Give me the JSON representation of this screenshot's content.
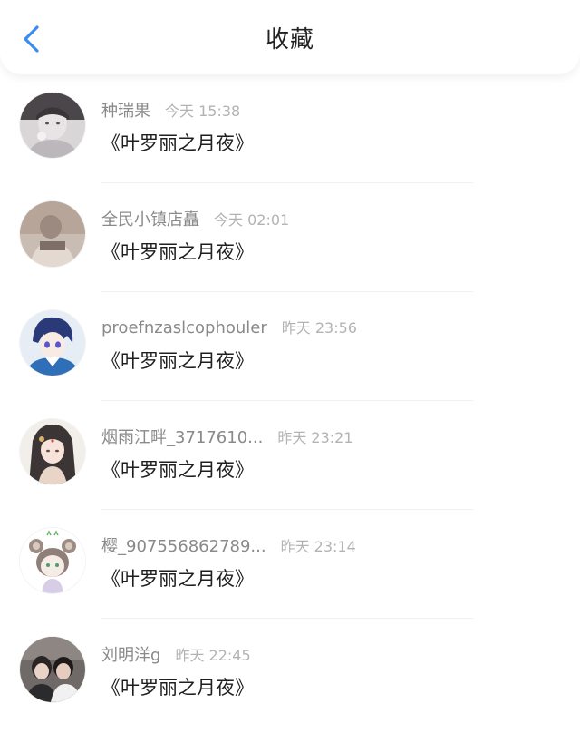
{
  "header": {
    "title": "收藏",
    "back_icon": "chevron-left-icon",
    "accent_color": "#3a8cf0"
  },
  "items": [
    {
      "name": "种瑞果",
      "time": "今天 15:38",
      "content": "《叶罗丽之月夜》",
      "avatar": "avatar-boy-gray-tint"
    },
    {
      "name": "全民小镇店矗",
      "time": "今天 02:01",
      "content": "《叶罗丽之月夜》",
      "avatar": "avatar-warm-photo"
    },
    {
      "name": "proefnzaslcophouler",
      "time": "昨天 23:56",
      "content": "《叶罗丽之月夜》",
      "avatar": "avatar-anime-blue-hair"
    },
    {
      "name": "烟雨江畔_3717610...",
      "time": "昨天 23:21",
      "content": "《叶罗丽之月夜》",
      "avatar": "avatar-anime-girl"
    },
    {
      "name": "樱_907556862789...",
      "time": "昨天 23:14",
      "content": "《叶罗丽之月夜》",
      "avatar": "avatar-raccoon-chibi"
    },
    {
      "name": "刘明洋g",
      "time": "昨天 22:45",
      "content": "《叶罗丽之月夜》",
      "avatar": "avatar-couple-photo"
    }
  ]
}
